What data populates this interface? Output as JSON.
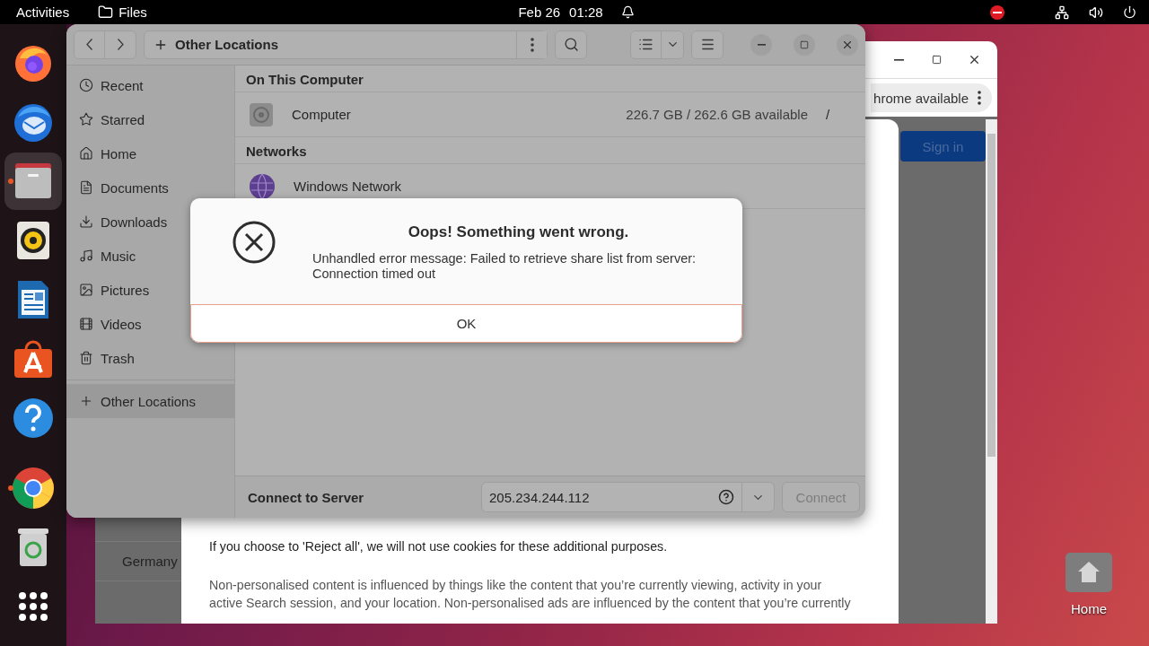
{
  "top_bar": {
    "activities": "Activities",
    "app_name": "Files",
    "date": "Feb 26",
    "time": "01:28"
  },
  "dock": [
    {
      "kind": "firefox",
      "running": false,
      "selected": false
    },
    {
      "kind": "thunderbird",
      "running": false,
      "selected": false
    },
    {
      "kind": "files",
      "running": true,
      "selected": true
    },
    {
      "kind": "rhythmbox",
      "running": false,
      "selected": false
    },
    {
      "kind": "writer",
      "running": false,
      "selected": false
    },
    {
      "kind": "appcenter",
      "running": false,
      "selected": false
    },
    {
      "kind": "help",
      "running": false,
      "selected": false
    },
    {
      "kind": "chrome",
      "running": true,
      "selected": false
    },
    {
      "kind": "trash",
      "running": false,
      "selected": false
    },
    {
      "kind": "apps",
      "running": false,
      "selected": false
    }
  ],
  "browser": {
    "menu_chip": "hrome available",
    "sign_in": "Sign in",
    "table_cell": "Germany",
    "notice": "If you choose to 'Reject all', we will not use cookies for these additional purposes.",
    "paragraph": "Non-personalised content is influenced by things like the content that you’re currently viewing, activity in your active Search session, and your location. Non-personalised ads are influenced by the content that you’re currently"
  },
  "files": {
    "path": "Other Locations",
    "sidebar": [
      {
        "label": "Recent",
        "kind": "recent",
        "selected": false
      },
      {
        "label": "Starred",
        "kind": "starred",
        "selected": false
      },
      {
        "label": "Home",
        "kind": "home",
        "selected": false
      },
      {
        "label": "Documents",
        "kind": "documents",
        "selected": false
      },
      {
        "label": "Downloads",
        "kind": "downloads",
        "selected": false
      },
      {
        "label": "Music",
        "kind": "music",
        "selected": false
      },
      {
        "label": "Pictures",
        "kind": "pictures",
        "selected": false
      },
      {
        "label": "Videos",
        "kind": "videos",
        "selected": false
      },
      {
        "label": "Trash",
        "kind": "trash",
        "selected": false
      },
      {
        "label": "Other Locations",
        "kind": "other",
        "selected": true
      }
    ],
    "sections": [
      {
        "title": "On This Computer",
        "items": [
          {
            "kind": "drive",
            "name": "Computer",
            "usage": "226.7 GB / 262.6 GB available",
            "mount": "/"
          }
        ]
      },
      {
        "title": "Networks",
        "items": [
          {
            "kind": "network",
            "name": "Windows Network"
          }
        ]
      }
    ],
    "connect": {
      "label": "Connect to Server",
      "value": "205.234.244.112",
      "button": "Connect",
      "disabled": true
    }
  },
  "dialog": {
    "title": "Oops! Something went wrong.",
    "message": "Unhandled error message: Failed to retrieve share list from server: Connection timed out",
    "button": "OK"
  },
  "desktop": [
    {
      "label": "Home"
    }
  ]
}
